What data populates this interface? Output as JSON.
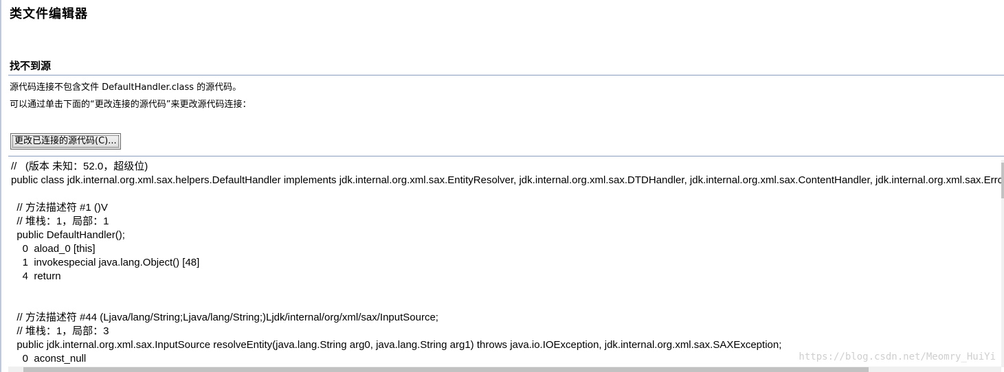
{
  "editor": {
    "title": "类文件编辑器"
  },
  "source_not_found": {
    "heading": "找不到源",
    "message_line1": "源代码连接不包含文件 DefaultHandler.class 的源代码。",
    "message_line2": "可以通过单击下面的“更改连接的源代码”来更改源代码连接：",
    "change_button_label": "更改已连接的源代码(C)..."
  },
  "code": {
    "lines": [
      "//   (版本 未知：52.0，超级位)",
      "public class jdk.internal.org.xml.sax.helpers.DefaultHandler implements jdk.internal.org.xml.sax.EntityResolver, jdk.internal.org.xml.sax.DTDHandler, jdk.internal.org.xml.sax.ContentHandler, jdk.internal.org.xml.sax.ErrorHandler {",
      "",
      "  // 方法描述符 #1 ()V",
      "  // 堆栈：1，局部：1",
      "  public DefaultHandler();",
      "    0  aload_0 [this]",
      "    1  invokespecial java.lang.Object() [48]",
      "    4  return",
      "",
      "",
      "  // 方法描述符 #44 (Ljava/lang/String;Ljava/lang/String;)Ljdk/internal/org/xml/sax/InputSource;",
      "  // 堆栈：1，局部：3",
      "  public jdk.internal.org.xml.sax.InputSource resolveEntity(java.lang.String arg0, java.lang.String arg1) throws java.io.IOException, jdk.internal.org.xml.sax.SAXException;",
      "    0  aconst_null"
    ]
  },
  "watermark": "https://blog.csdn.net/Meomry_HuiYi"
}
